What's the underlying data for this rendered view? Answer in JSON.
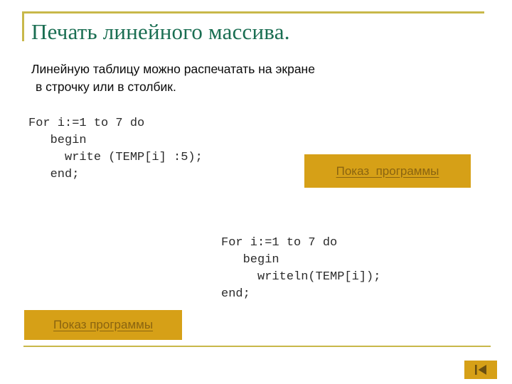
{
  "slide": {
    "title": "Печать линейного массива.",
    "subtitle": {
      "line1": "Линейную таблицу можно распечатать на экране",
      "line2": "в строчку или в столбик."
    },
    "code_blocks": [
      {
        "id": "write-loop",
        "text": "For i:=1 to 7 do\n   begin\n     write (TEMP[i] :5);\n   end;"
      },
      {
        "id": "writeln-loop",
        "text": "For i:=1 to 7 do\n   begin\n     writeln(TEMP[i]);\nend;"
      }
    ],
    "buttons": [
      {
        "id": "show-program-1",
        "label": "Показ  программы"
      },
      {
        "id": "show-program-2",
        "label": "Показ программы"
      }
    ],
    "navigation": {
      "first_slide_icon": "skip-to-start-icon"
    },
    "colors": {
      "title_green": "#1a6e52",
      "rule_gold": "#c8b84a",
      "button_gold": "#d6a017",
      "button_text": "#8a6410",
      "body_text": "#0a0a0a",
      "code_text": "#2b2b2b"
    }
  }
}
